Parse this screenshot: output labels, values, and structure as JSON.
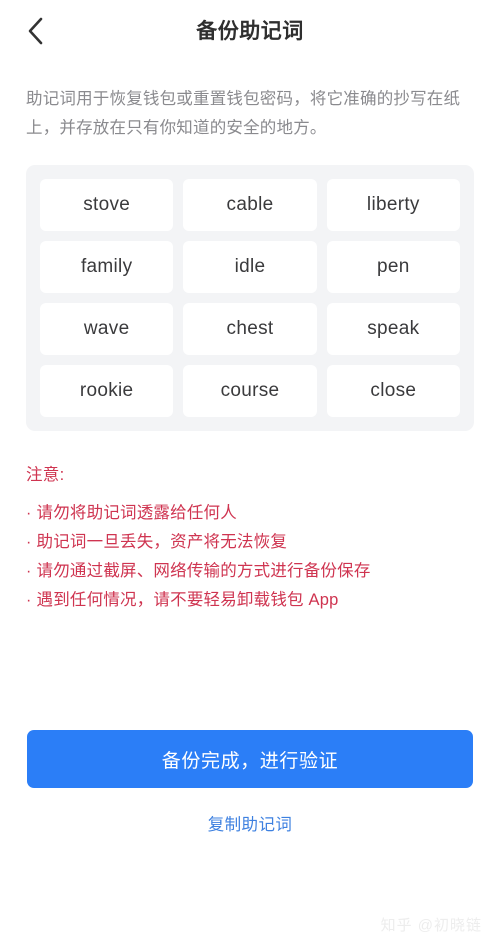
{
  "header": {
    "title": "备份助记词",
    "back_icon": "chevron-left-icon"
  },
  "description": "助记词用于恢复钱包或重置钱包密码，将它准确的抄写在纸上，并存放在只有你知道的安全的地方。",
  "mnemonic": {
    "words": [
      "stove",
      "cable",
      "liberty",
      "family",
      "idle",
      "pen",
      "wave",
      "chest",
      "speak",
      "rookie",
      "course",
      "close"
    ]
  },
  "warning": {
    "title": "注意:",
    "bullet": "·",
    "items": [
      "请勿将助记词透露给任何人",
      "助记词一旦丢失，资产将无法恢复",
      "请勿通过截屏、网络传输的方式进行备份保存",
      "遇到任何情况，请不要轻易卸载钱包 App"
    ]
  },
  "actions": {
    "primary_label": "备份完成，进行验证",
    "secondary_label": "复制助记词"
  },
  "watermark": "知乎 @初晓链",
  "colors": {
    "accent_blue": "#2b7ef7",
    "link_blue": "#3d80e0",
    "warning_red": "#cf3450",
    "card_bg": "#f3f4f6",
    "chip_bg": "#ffffff",
    "text_primary": "#333333",
    "text_muted": "#8a8a8e"
  }
}
